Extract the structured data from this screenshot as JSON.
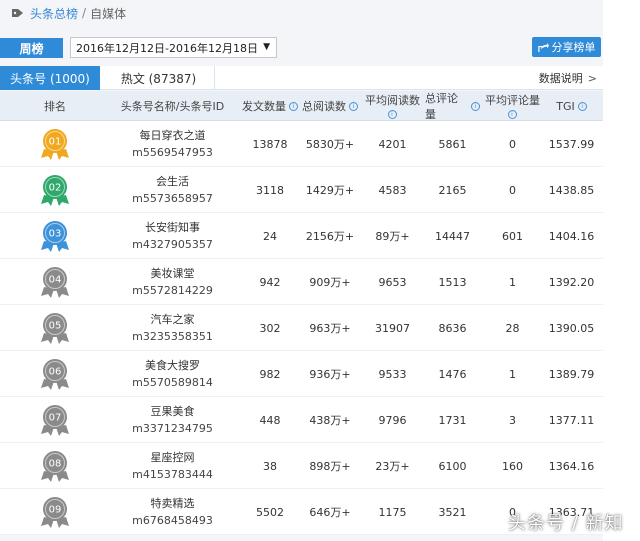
{
  "breadcrumb": {
    "link": "头条总榜",
    "separator": "/",
    "current": "自媒体"
  },
  "period": {
    "label": "周榜",
    "selected": "2016年12月12日-2016年12月18日"
  },
  "share_button": {
    "label": "分享榜单",
    "icon": "share-icon"
  },
  "tabs": [
    {
      "label": "头条号 (1000)",
      "active": true
    },
    {
      "label": "热文 (87387)",
      "active": false
    }
  ],
  "data_note": {
    "label": "数据说明",
    "arrow": ">"
  },
  "table": {
    "headers": {
      "rank": "排名",
      "name": "头条号名称/头条号ID",
      "posts": "发文数量",
      "total_reads": "总阅读数",
      "avg_reads": "平均阅读数",
      "total_comments": "总评论量",
      "avg_comments": "平均评论量",
      "tgi": "TGI"
    },
    "rows": [
      {
        "rank": "01",
        "name": "每日穿衣之道",
        "id": "m5569547953",
        "posts": "13878",
        "total_reads": "5830万+",
        "avg_reads": "4201",
        "total_comments": "5861",
        "avg_comments": "0",
        "tgi": "1537.99"
      },
      {
        "rank": "02",
        "name": "会生活",
        "id": "m5573658957",
        "posts": "3118",
        "total_reads": "1429万+",
        "avg_reads": "4583",
        "total_comments": "2165",
        "avg_comments": "0",
        "tgi": "1438.85"
      },
      {
        "rank": "03",
        "name": "长安街知事",
        "id": "m4327905357",
        "posts": "24",
        "total_reads": "2156万+",
        "avg_reads": "89万+",
        "total_comments": "14447",
        "avg_comments": "601",
        "tgi": "1404.16"
      },
      {
        "rank": "04",
        "name": "美妆课堂",
        "id": "m5572814229",
        "posts": "942",
        "total_reads": "909万+",
        "avg_reads": "9653",
        "total_comments": "1513",
        "avg_comments": "1",
        "tgi": "1392.20"
      },
      {
        "rank": "05",
        "name": "汽车之家",
        "id": "m3235358351",
        "posts": "302",
        "total_reads": "963万+",
        "avg_reads": "31907",
        "total_comments": "8636",
        "avg_comments": "28",
        "tgi": "1390.05"
      },
      {
        "rank": "06",
        "name": "美食大搜罗",
        "id": "m5570589814",
        "posts": "982",
        "total_reads": "936万+",
        "avg_reads": "9533",
        "total_comments": "1476",
        "avg_comments": "1",
        "tgi": "1389.79"
      },
      {
        "rank": "07",
        "name": "豆果美食",
        "id": "m3371234795",
        "posts": "448",
        "total_reads": "438万+",
        "avg_reads": "9796",
        "total_comments": "1731",
        "avg_comments": "3",
        "tgi": "1377.11"
      },
      {
        "rank": "08",
        "name": "星座控网",
        "id": "m4153783444",
        "posts": "38",
        "total_reads": "898万+",
        "avg_reads": "23万+",
        "total_comments": "6100",
        "avg_comments": "160",
        "tgi": "1364.16"
      },
      {
        "rank": "09",
        "name": "特卖精选",
        "id": "m6768458493",
        "posts": "5502",
        "total_reads": "646万+",
        "avg_reads": "1175",
        "total_comments": "3521",
        "avg_comments": "0",
        "tgi": "1363.71"
      }
    ]
  },
  "medal_colors": {
    "01": "#f0a91e",
    "02": "#2fa86b",
    "03": "#3d92d8",
    "default": "#8a8a8a"
  },
  "accent_color": "#2f8ad8",
  "watermark": "头条号 / 新知"
}
